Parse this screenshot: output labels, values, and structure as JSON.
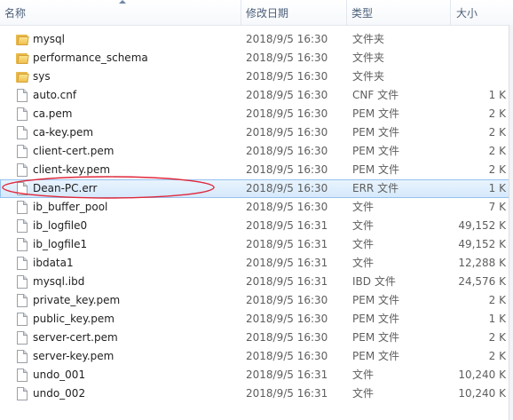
{
  "columns": {
    "name": "名称",
    "date": "修改日期",
    "type": "类型",
    "size": "大小"
  },
  "files": [
    {
      "name": "mysql",
      "date": "2018/9/5 16:30",
      "type": "文件夹",
      "size": "",
      "kind": "folder"
    },
    {
      "name": "performance_schema",
      "date": "2018/9/5 16:30",
      "type": "文件夹",
      "size": "",
      "kind": "folder"
    },
    {
      "name": "sys",
      "date": "2018/9/5 16:30",
      "type": "文件夹",
      "size": "",
      "kind": "folder"
    },
    {
      "name": "auto.cnf",
      "date": "2018/9/5 16:30",
      "type": "CNF 文件",
      "size": "1 K",
      "kind": "file"
    },
    {
      "name": "ca.pem",
      "date": "2018/9/5 16:30",
      "type": "PEM 文件",
      "size": "2 K",
      "kind": "file"
    },
    {
      "name": "ca-key.pem",
      "date": "2018/9/5 16:30",
      "type": "PEM 文件",
      "size": "2 K",
      "kind": "file"
    },
    {
      "name": "client-cert.pem",
      "date": "2018/9/5 16:30",
      "type": "PEM 文件",
      "size": "2 K",
      "kind": "file"
    },
    {
      "name": "client-key.pem",
      "date": "2018/9/5 16:30",
      "type": "PEM 文件",
      "size": "2 K",
      "kind": "file"
    },
    {
      "name": "Dean-PC.err",
      "date": "2018/9/5 16:30",
      "type": "ERR 文件",
      "size": "1 K",
      "kind": "file",
      "selected": true
    },
    {
      "name": "ib_buffer_pool",
      "date": "2018/9/5 16:30",
      "type": "文件",
      "size": "7 K",
      "kind": "file"
    },
    {
      "name": "ib_logfile0",
      "date": "2018/9/5 16:31",
      "type": "文件",
      "size": "49,152 K",
      "kind": "file"
    },
    {
      "name": "ib_logfile1",
      "date": "2018/9/5 16:31",
      "type": "文件",
      "size": "49,152 K",
      "kind": "file"
    },
    {
      "name": "ibdata1",
      "date": "2018/9/5 16:31",
      "type": "文件",
      "size": "12,288 K",
      "kind": "file"
    },
    {
      "name": "mysql.ibd",
      "date": "2018/9/5 16:31",
      "type": "IBD 文件",
      "size": "24,576 K",
      "kind": "file"
    },
    {
      "name": "private_key.pem",
      "date": "2018/9/5 16:30",
      "type": "PEM 文件",
      "size": "2 K",
      "kind": "file"
    },
    {
      "name": "public_key.pem",
      "date": "2018/9/5 16:30",
      "type": "PEM 文件",
      "size": "1 K",
      "kind": "file"
    },
    {
      "name": "server-cert.pem",
      "date": "2018/9/5 16:30",
      "type": "PEM 文件",
      "size": "2 K",
      "kind": "file"
    },
    {
      "name": "server-key.pem",
      "date": "2018/9/5 16:30",
      "type": "PEM 文件",
      "size": "2 K",
      "kind": "file"
    },
    {
      "name": "undo_001",
      "date": "2018/9/5 16:31",
      "type": "文件",
      "size": "10,240 K",
      "kind": "file"
    },
    {
      "name": "undo_002",
      "date": "2018/9/5 16:31",
      "type": "文件",
      "size": "10,240 K",
      "kind": "file"
    }
  ],
  "colors": {
    "selection": "#d4e8fb",
    "selection_border": "#95c2ee",
    "annotation": "#e0283c",
    "header_text": "#4c607a",
    "folder": "#f0c04f"
  },
  "icons": {
    "folder": "folder-icon",
    "file": "file-icon",
    "sort": "sort-up-arrow-icon"
  }
}
